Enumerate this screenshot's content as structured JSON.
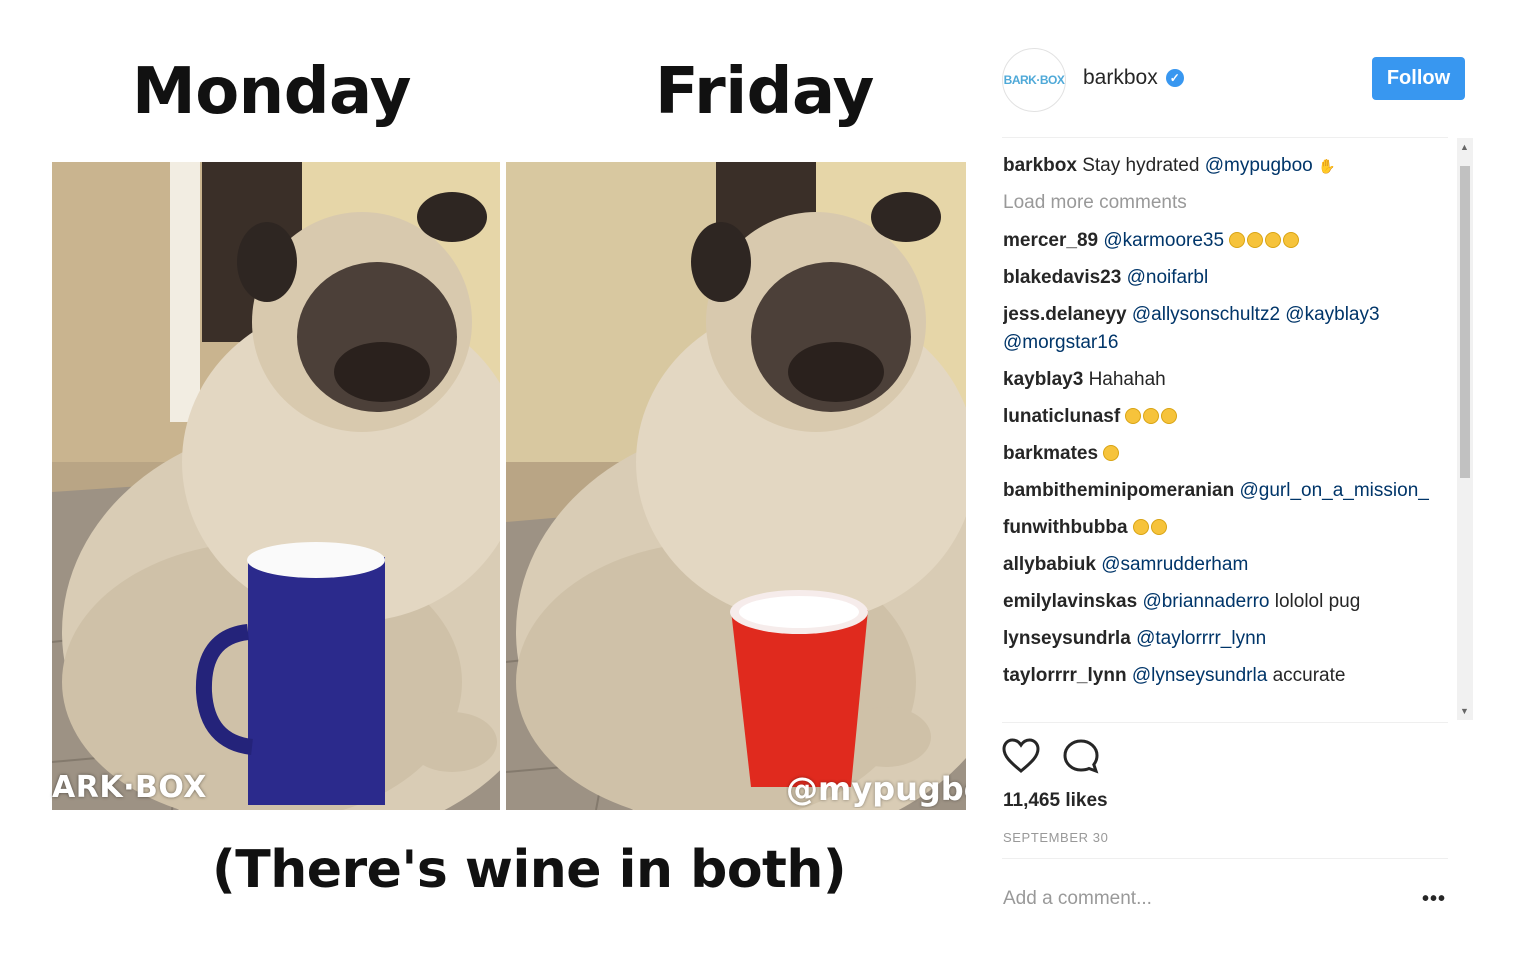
{
  "meme": {
    "title_left": "Monday",
    "title_right": "Friday",
    "caption": "(There's wine in both)",
    "watermark_left": "ARK·BOX",
    "watermark_right": "@mypugboo",
    "mug_color": "#2b2a8c",
    "cup_color": "#e02a1e"
  },
  "post": {
    "avatar_text": "BARK·BOX",
    "username": "barkbox",
    "verified_icon": "verified-check",
    "follow_label": "Follow",
    "caption": {
      "user": "barkbox",
      "text": "Stay hydrated",
      "mention": "@mypugboo"
    },
    "load_more": "Load more comments",
    "comments": [
      {
        "user": "mercer_89",
        "mention": "@karmoore35",
        "text": "",
        "emoji": 4
      },
      {
        "user": "blakedavis23",
        "mention": "@noifarbl",
        "text": "",
        "emoji": 0
      },
      {
        "user": "jess.delaneyy",
        "mention": "@allysonschultz2 @kayblay3 @morgstar16",
        "text": "",
        "emoji": 0
      },
      {
        "user": "kayblay3",
        "mention": "",
        "text": "Hahahah",
        "emoji": 0
      },
      {
        "user": "lunaticlunasf",
        "mention": "",
        "text": "",
        "emoji": 3
      },
      {
        "user": "barkmates",
        "mention": "",
        "text": "",
        "emoji": 1
      },
      {
        "user": "bambitheminipomeranian",
        "mention": "@gurl_on_a_mission_",
        "text": "",
        "emoji": 0
      },
      {
        "user": "funwithbubba",
        "mention": "",
        "text": "",
        "emoji": 2
      },
      {
        "user": "allybabiuk",
        "mention": "@samrudderham",
        "text": "",
        "emoji": 0
      },
      {
        "user": "emilylavinskas",
        "mention": "@briannaderro",
        "text": "lololol pug",
        "emoji": 0
      },
      {
        "user": "lynseysundrla",
        "mention": "@taylorrrr_lynn",
        "text": "",
        "emoji": 0
      },
      {
        "user": "taylorrrr_lynn",
        "mention": "@lynseysundrla",
        "text": "accurate",
        "emoji": 0
      }
    ],
    "likes": "11,465 likes",
    "date": "SEPTEMBER 30",
    "add_comment_placeholder": "Add a comment...",
    "more_label": "•••",
    "accent": "#3897f0"
  }
}
